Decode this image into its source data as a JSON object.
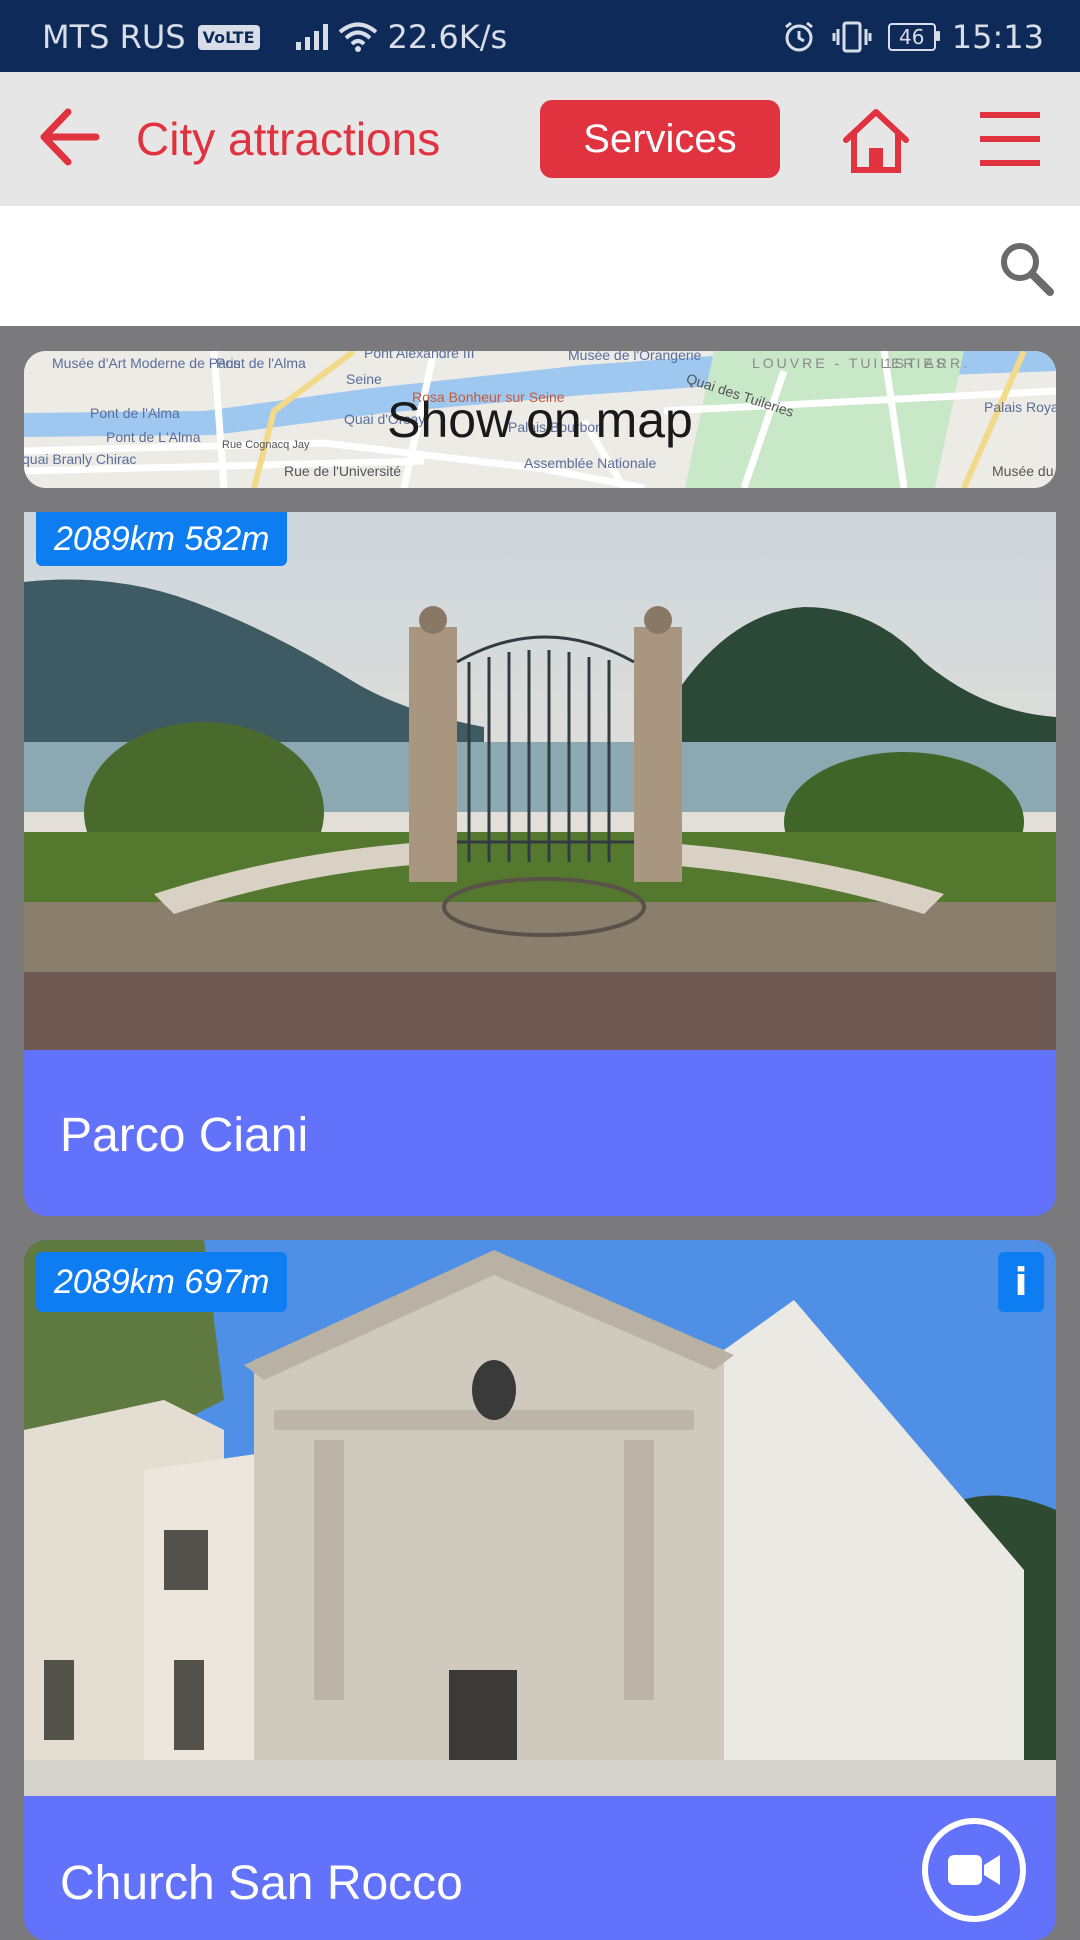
{
  "status_bar": {
    "carrier": "MTS RUS",
    "volte": "VoLTE",
    "speed": "22.6K/s",
    "battery": "46",
    "time": "15:13"
  },
  "app_bar": {
    "title": "City attractions",
    "services_label": "Services"
  },
  "search": {
    "placeholder": ""
  },
  "map_banner": {
    "label": "Show on map",
    "map_labels": [
      "Musée d'Art Moderne de Paris",
      "Pont de l'Alma",
      "Pont Alexandre III",
      "Seine",
      "Musée de l'Orangerie",
      "LOUVRE - TUILERIES",
      "1ST ARR.",
      "Palais Royal",
      "Musée du Louvre",
      "Rosa Bonheur sur Seine",
      "Quai d'Orsay",
      "Palais Bourbon",
      "Assemblée Nationale",
      "Rue de l'Université",
      "Rue Cognacq Jay",
      "Pont de l'Alma",
      "Pont de L'Alma",
      "quai Branly Chirac",
      "Quai des Tuileries"
    ]
  },
  "attractions": [
    {
      "name": "Parco Ciani",
      "distance": "2089km 582m"
    },
    {
      "name": "Church San Rocco",
      "distance": "2089km 697m",
      "info": "i"
    }
  ],
  "colors": {
    "status_bar": "#0e2a58",
    "accent_red": "#e0333f",
    "card_footer": "#6272fb",
    "badge_blue": "#0f7df2"
  },
  "icons": [
    "arrow-left-icon",
    "home-icon",
    "hamburger-menu-icon",
    "search-icon",
    "info-icon",
    "video-camera-icon"
  ]
}
